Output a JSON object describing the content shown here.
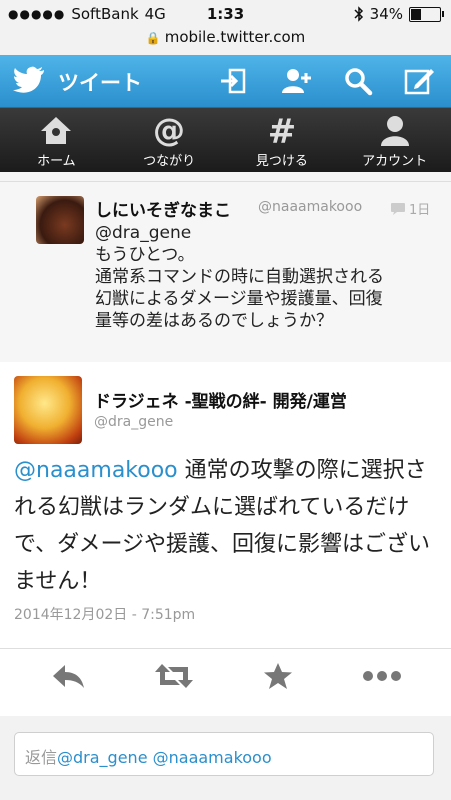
{
  "status": {
    "carrier": "SoftBank",
    "network": "4G",
    "time": "1:33",
    "battery": "34%"
  },
  "url": "mobile.twitter.com",
  "topbar": {
    "title": "ツイート"
  },
  "tabs": [
    {
      "label": "ホーム",
      "icon": "home-icon"
    },
    {
      "label": "つながり",
      "icon": "at-icon"
    },
    {
      "label": "見つける",
      "icon": "hash-icon"
    },
    {
      "label": "アカウント",
      "icon": "person-icon"
    }
  ],
  "reply_tweet": {
    "name": "しにいそぎなまこ",
    "handle": "@naaamakooo",
    "time": "1日",
    "mention": "@dra_gene",
    "lines": [
      "もうひとつ。",
      "通常系コマンドの時に自動選択される",
      "幻獣によるダメージ量や援護量、回復",
      "量等の差はあるのでしょうか？"
    ]
  },
  "main_tweet": {
    "name": "ドラジェネ -聖戦の絆- 開発/運営",
    "handle": "@dra_gene",
    "mention": "@naaamakooo",
    "text": " 通常の攻撃の際に選択される幻獣はランダムに選ばれているだけで、ダメージや援護、回復に影響はございません！",
    "date": "2014年12月02日 - 7:51pm"
  },
  "reply_box": {
    "prefix": "返信",
    "mentions": "@dra_gene @naaamakooo"
  },
  "colors": {
    "accent": "#2a8fcd",
    "topbar": "#4fb4e8",
    "tabbar": "#1b1b1b"
  }
}
